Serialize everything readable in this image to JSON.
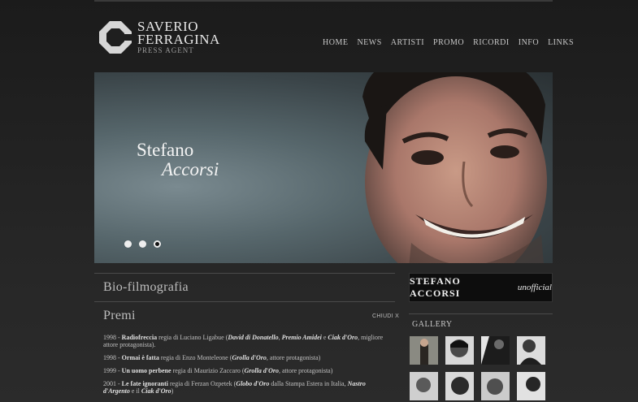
{
  "logo": {
    "line1": "SAVERIO",
    "line2": "FERRAGINA",
    "tagline": "PRESS AGENT"
  },
  "nav": [
    "HOME",
    "NEWS",
    "ARTISTI",
    "PROMO",
    "RICORDI",
    "INFO",
    "LINKS"
  ],
  "hero": {
    "first_name": "Stefano",
    "last_name": "Accorsi",
    "slides": 3,
    "active_slide": 3
  },
  "sections": {
    "bio_title": "Bio-filmografia",
    "premi_title": "Premi",
    "close_label": "CHIUDI X"
  },
  "awards": [
    {
      "year": "1998 - ",
      "film": "Radiofreccia",
      "mid": " regia di Luciano Ligabue (",
      "prize": "David di Donatello",
      "sep": ", ",
      "prize2": "Premio Amidei",
      "sep2": " e ",
      "prize3": "Ciak d'Oro",
      "tail": ", migliore attore protagonista)."
    },
    {
      "year": "1998 - ",
      "film": "Ormai è fatta",
      "mid": " regia di Enzo Monteleone (",
      "prize": "Grolla d'Oro",
      "sep": "",
      "prize2": "",
      "sep2": "",
      "prize3": "",
      "tail": ", attore protagonista)"
    },
    {
      "year": "1999 - ",
      "film": "Un uomo perbene",
      "mid": " regia di Maurizio Zaccaro (",
      "prize": "Grolla d'Oro",
      "sep": "",
      "prize2": "",
      "sep2": "",
      "prize3": "",
      "tail": ", attore protagonista)"
    },
    {
      "year": "2001 - ",
      "film": "Le fate ignoranti",
      "mid": " regia di Ferzan Ozpetek (",
      "prize": "Globo d'Oro",
      "sep": " dalla Stampa Estera in Italia, ",
      "prize2": "Nastro d'Argento",
      "sep2": " e il ",
      "prize3": "Ciak d'Oro",
      "tail": ")"
    }
  ],
  "sidebar": {
    "banner_bold": "STEFANO ACCORSI",
    "banner_italic": "unofficial",
    "gallery_title": "GALLERY"
  },
  "colors": {
    "background": "#1e1e1e",
    "text": "#c0c0c0",
    "accent": "#ffffff"
  }
}
